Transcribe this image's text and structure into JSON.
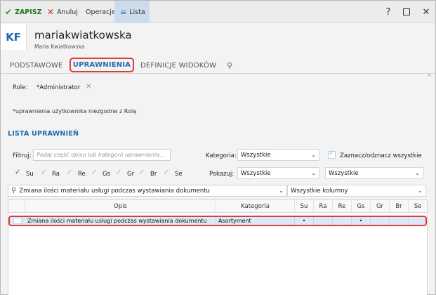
{
  "toolbar": {
    "save_label": "ZAPISZ",
    "cancel_label": "Anuluj",
    "operations_label": "Operacje",
    "list_label": "Lista",
    "help_label": "?",
    "close_label": "✕"
  },
  "header": {
    "avatar_initials": "KF",
    "login": "mariakwiatkowska",
    "full_name": "Maria Kwiatkowska"
  },
  "tabs": [
    {
      "label": "PODSTAWOWE",
      "active": false
    },
    {
      "label": "UPRAWNIENIA",
      "active": true
    },
    {
      "label": "DEFINICJE WIDOKÓW",
      "active": false
    }
  ],
  "role": {
    "label": "Role:",
    "value": "*Administrator"
  },
  "note": "*uprawnienia użytkownika niezgodne z Rolą",
  "section_title": "LISTA UPRAWNIEŃ",
  "filters": {
    "filter_label": "Filtruj:",
    "filter_placeholder": "Podaj część opisu lub kategorii uprawnienia...",
    "category_label": "Kategoria:",
    "category_value": "Wszystkie",
    "select_all_label": "Zaznacz/odznacz wszystkie",
    "show_label": "Pokazuj:",
    "show_value": "Wszystkie",
    "show_value_2": "Wszystkie",
    "rights": [
      {
        "label": "Su",
        "checked": true
      },
      {
        "label": "Ra",
        "checked": false
      },
      {
        "label": "Re",
        "checked": false
      },
      {
        "label": "Gs",
        "checked": false
      },
      {
        "label": "Gr",
        "checked": false
      },
      {
        "label": "Br",
        "checked": false
      },
      {
        "label": "Se",
        "checked": false
      }
    ],
    "search_value": "Zmiana ilości materiału usługi podczas wystawiania dokumentu",
    "columns_value": "Wszystkie kolumny"
  },
  "table": {
    "columns": [
      "Opis",
      "Kategoria",
      "Su",
      "Ra",
      "Re",
      "Gs",
      "Gr",
      "Br",
      "Se"
    ],
    "rows": [
      {
        "opis": "Zmiana ilości materiału usługi podczas wystawiania dokumentu",
        "kategoria": "Asortyment",
        "su": "•",
        "ra": "",
        "re": "",
        "gs": "•",
        "gr": "",
        "br": "",
        "se": ""
      }
    ]
  },
  "colors": {
    "accent": "#1f6bb0",
    "highlight_border": "#e03a3a",
    "selected_row": "#dce8f5",
    "save_green": "#2e9a2e"
  }
}
